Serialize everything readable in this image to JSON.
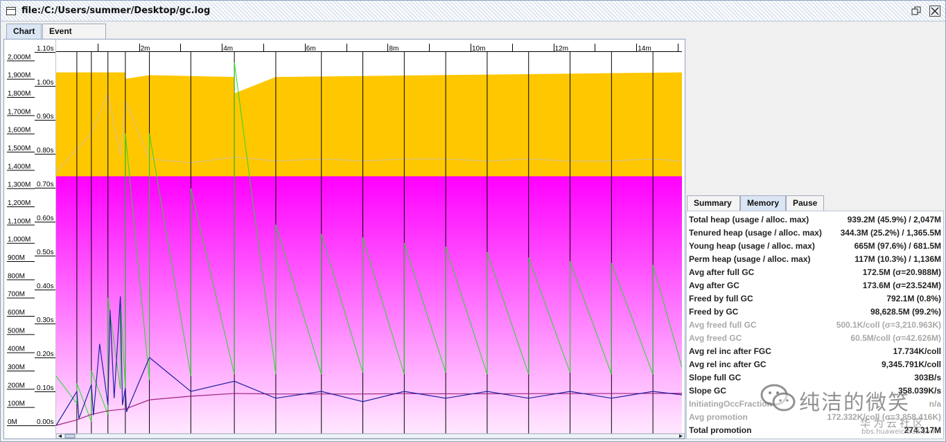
{
  "window": {
    "title": "file:/C:/Users/summer/Desktop/gc.log"
  },
  "main_tabs": [
    {
      "label": "Chart",
      "active": true
    },
    {
      "label": "Event details",
      "active": false
    }
  ],
  "side_tabs": [
    {
      "label": "Summary",
      "active": false
    },
    {
      "label": "Memory",
      "active": true
    },
    {
      "label": "Pause",
      "active": false
    }
  ],
  "memory_rows": [
    {
      "label": "Total heap (usage / alloc. max)",
      "value": "939.2M (45.9%) / 2,047M",
      "dim": false
    },
    {
      "label": "Tenured heap (usage / alloc. max)",
      "value": "344.3M (25.2%) / 1,365.5M",
      "dim": false
    },
    {
      "label": "Young heap (usage / alloc. max)",
      "value": "665M (97.6%) / 681.5M",
      "dim": false
    },
    {
      "label": "Perm heap (usage / alloc. max)",
      "value": "117M (10.3%) / 1,136M",
      "dim": false
    },
    {
      "label": "Avg after full GC",
      "value": "172.5M (σ=20.988M)",
      "dim": false
    },
    {
      "label": "Avg after GC",
      "value": "173.6M (σ=23.524M)",
      "dim": false
    },
    {
      "label": "Freed by full GC",
      "value": "792.1M (0.8%)",
      "dim": false
    },
    {
      "label": "Freed by GC",
      "value": "98,628.5M (99.2%)",
      "dim": false
    },
    {
      "label": "Avg freed full GC",
      "value": "500.1K/coll (σ=3,210.963K)",
      "dim": true
    },
    {
      "label": "Avg freed GC",
      "value": "60.5M/coll (σ=42.626M)",
      "dim": true
    },
    {
      "label": "Avg rel inc after FGC",
      "value": "17.734K/coll",
      "dim": false
    },
    {
      "label": "Avg rel inc after GC",
      "value": "9,345.791K/coll",
      "dim": false
    },
    {
      "label": "Slope full GC",
      "value": "303B/s",
      "dim": false
    },
    {
      "label": "Slope GC",
      "value": "358.039K/s",
      "dim": false
    },
    {
      "label": "InitiatingOccFraction",
      "value": "n/a",
      "dim": true
    },
    {
      "label": "Avg promotion",
      "value": "172.332K/coll (σ=3,858.416K)",
      "dim": true
    },
    {
      "label": "Total promotion",
      "value": "274.317M",
      "dim": false
    }
  ],
  "watermark": {
    "text": "纯洁的微笑",
    "sub": "华为云社区",
    "url": "bbs.huaweicloud.com"
  },
  "colors": {
    "young": "#ffc700",
    "tenured_top": "#ff00ff",
    "tenured_bottom": "#ffe8ff",
    "gc_line": "#000000",
    "used_heap": "#2ad62a",
    "pause": "#2020a0",
    "promotion": "#a02080"
  },
  "chart_data": {
    "type": "area",
    "x_unit": "minutes",
    "x_ticks": [
      "2m",
      "4m",
      "6m",
      "8m",
      "10m",
      "12m",
      "14m"
    ],
    "x_tick_values": [
      2,
      4,
      6,
      8,
      10,
      12,
      14
    ],
    "xlim": [
      0,
      15.1
    ],
    "y_memory_ticks": [
      "0M",
      "100M",
      "200M",
      "300M",
      "400M",
      "500M",
      "600M",
      "700M",
      "800M",
      "900M",
      "1,000M",
      "1,100M",
      "1,200M",
      "1,300M",
      "1,400M",
      "1,500M",
      "1,600M",
      "1,700M",
      "1,800M",
      "1,900M",
      "2,000M"
    ],
    "y_memory_lim": [
      0,
      2047
    ],
    "y_pause_ticks": [
      "0.00s",
      "0.10s",
      "0.20s",
      "0.30s",
      "0.40s",
      "0.50s",
      "0.60s",
      "0.70s",
      "0.80s",
      "0.90s",
      "1.00s",
      "1.10s"
    ],
    "y_pause_lim": [
      0,
      1.1
    ],
    "tenured_alloc_mb": 1365.5,
    "total_alloc": {
      "x": [
        0,
        1.67,
        1.67,
        2.25,
        2.25,
        4.3,
        4.3,
        5.3,
        5.3,
        15.1
      ],
      "y": [
        1935,
        1935,
        1900,
        1920,
        1920,
        1910,
        1820,
        1910,
        1910,
        1935
      ]
    },
    "gc_times": [
      0.5,
      0.85,
      1.25,
      1.67,
      2.25,
      3.25,
      4.3,
      5.3,
      6.4,
      7.4,
      8.4,
      9.4,
      10.4,
      11.4,
      12.4,
      13.4,
      14.4
    ],
    "used_heap": {
      "x": [
        0,
        0.5,
        0.5,
        0.85,
        0.85,
        1.25,
        1.25,
        1.55,
        1.55,
        1.67,
        1.67,
        2.25,
        2.25,
        3.25,
        3.25,
        4.3,
        4.3,
        5.3,
        5.3,
        6.4,
        6.4,
        7.4,
        7.4,
        8.4,
        8.4,
        9.4,
        9.4,
        10.4,
        10.4,
        11.4,
        11.4,
        12.4,
        12.4,
        13.4,
        13.4,
        14.4,
        14.4,
        15.1
      ],
      "y": [
        270,
        120,
        230,
        20,
        300,
        60,
        700,
        200,
        700,
        200,
        1600,
        250,
        1600,
        270,
        1300,
        280,
        1990,
        280,
        1100,
        280,
        1050,
        290,
        1030,
        280,
        1000,
        290,
        980,
        280,
        950,
        280,
        920,
        290,
        900,
        280,
        890,
        280,
        880,
        320
      ]
    },
    "pause_s": {
      "x": [
        0,
        0.5,
        0.55,
        0.85,
        0.9,
        1.05,
        1.25,
        1.3,
        1.4,
        1.55,
        1.6,
        1.67,
        1.7,
        2.25,
        3.25,
        4.3,
        5.3,
        6.4,
        7.4,
        8.4,
        9.4,
        10.4,
        11.4,
        12.4,
        13.4,
        14.4,
        15.1
      ],
      "y": [
        0.0,
        0.1,
        0.02,
        0.12,
        0.03,
        0.24,
        0.06,
        0.34,
        0.08,
        0.38,
        0.06,
        0.11,
        0.04,
        0.2,
        0.1,
        0.13,
        0.08,
        0.1,
        0.07,
        0.1,
        0.08,
        0.1,
        0.08,
        0.1,
        0.08,
        0.1,
        0.09
      ]
    },
    "tenured_after_gc_mb": {
      "x": [
        0,
        0.5,
        0.85,
        1.25,
        1.67,
        2.25,
        3.25,
        4.3,
        5.3,
        6.4,
        7.4,
        8.4,
        9.4,
        10.4,
        11.4,
        12.4,
        13.4,
        14.4,
        15.1
      ],
      "y": [
        0,
        30,
        60,
        80,
        90,
        140,
        160,
        175,
        172,
        172,
        172,
        174,
        173,
        173,
        174,
        174,
        175,
        175,
        176
      ]
    },
    "total_heap_after_gc_mb": {
      "x": [
        0,
        0.85,
        1.25,
        1.55,
        1.67,
        2.25,
        3.25,
        4.3,
        5.3,
        6.4,
        7.4,
        8.4,
        9.4,
        10.4,
        11.4,
        12.4,
        13.4,
        14.4,
        15.1
      ],
      "y": [
        1390,
        1600,
        1820,
        1480,
        1780,
        1460,
        1440,
        1470,
        1450,
        1460,
        1450,
        1460,
        1460,
        1450,
        1460,
        1450,
        1450,
        1460,
        1450
      ]
    }
  }
}
